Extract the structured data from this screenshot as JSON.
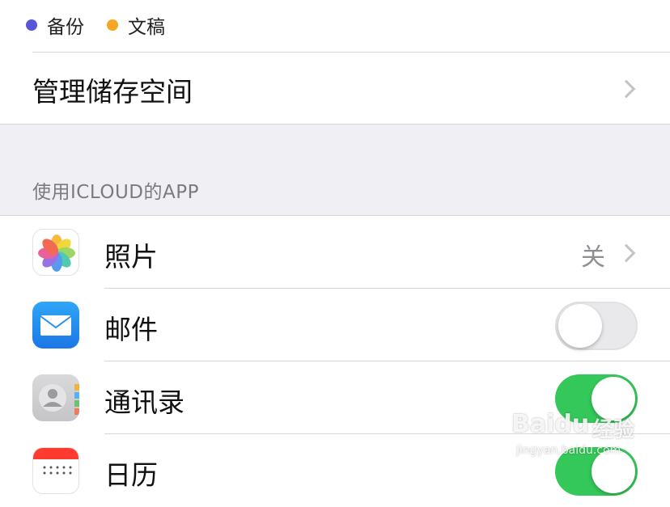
{
  "legend": {
    "items": [
      {
        "label": "备份",
        "color": "#5856d6"
      },
      {
        "label": "文稿",
        "color": "#f5a623"
      }
    ]
  },
  "manage_storage": {
    "label": "管理储存空间"
  },
  "apps_section": {
    "header": "使用ICLOUD的APP"
  },
  "apps": [
    {
      "name": "照片",
      "value": "关",
      "icon": "photos-icon",
      "control": "disclosure"
    },
    {
      "name": "邮件",
      "icon": "mail-icon",
      "control": "toggle",
      "toggle_on": false
    },
    {
      "name": "通讯录",
      "icon": "contacts-icon",
      "control": "toggle",
      "toggle_on": true
    },
    {
      "name": "日历",
      "icon": "calendar-icon",
      "control": "toggle",
      "toggle_on": true
    }
  ],
  "colors": {
    "toggle_on": "#34c759",
    "group_background": "#efeff4",
    "section_header_text": "#7a7a80"
  },
  "watermark": {
    "brand": "Baidu",
    "cn": "经验",
    "url": "jingyan.baidu.com"
  }
}
